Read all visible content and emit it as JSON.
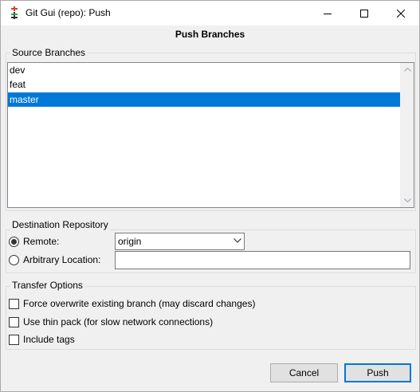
{
  "window": {
    "title": "Git Gui (repo): Push",
    "heading": "Push Branches"
  },
  "source": {
    "legend": "Source Branches",
    "branches": [
      {
        "name": "dev",
        "selected": false
      },
      {
        "name": "feat",
        "selected": false
      },
      {
        "name": "master",
        "selected": true
      }
    ]
  },
  "destination": {
    "legend": "Destination Repository",
    "remote_label": "Remote:",
    "remote_value": "origin",
    "arbitrary_label": "Arbitrary Location:",
    "arbitrary_value": "",
    "selected_option": "remote"
  },
  "transfer": {
    "legend": "Transfer Options",
    "options": [
      {
        "label": "Force overwrite existing branch (may discard changes)",
        "checked": false
      },
      {
        "label": "Use thin pack (for slow network connections)",
        "checked": false
      },
      {
        "label": "Include tags",
        "checked": false
      }
    ]
  },
  "buttons": {
    "cancel": "Cancel",
    "push": "Push"
  },
  "colors": {
    "selection": "#0078d7",
    "window_bg": "#f0f0f0"
  }
}
